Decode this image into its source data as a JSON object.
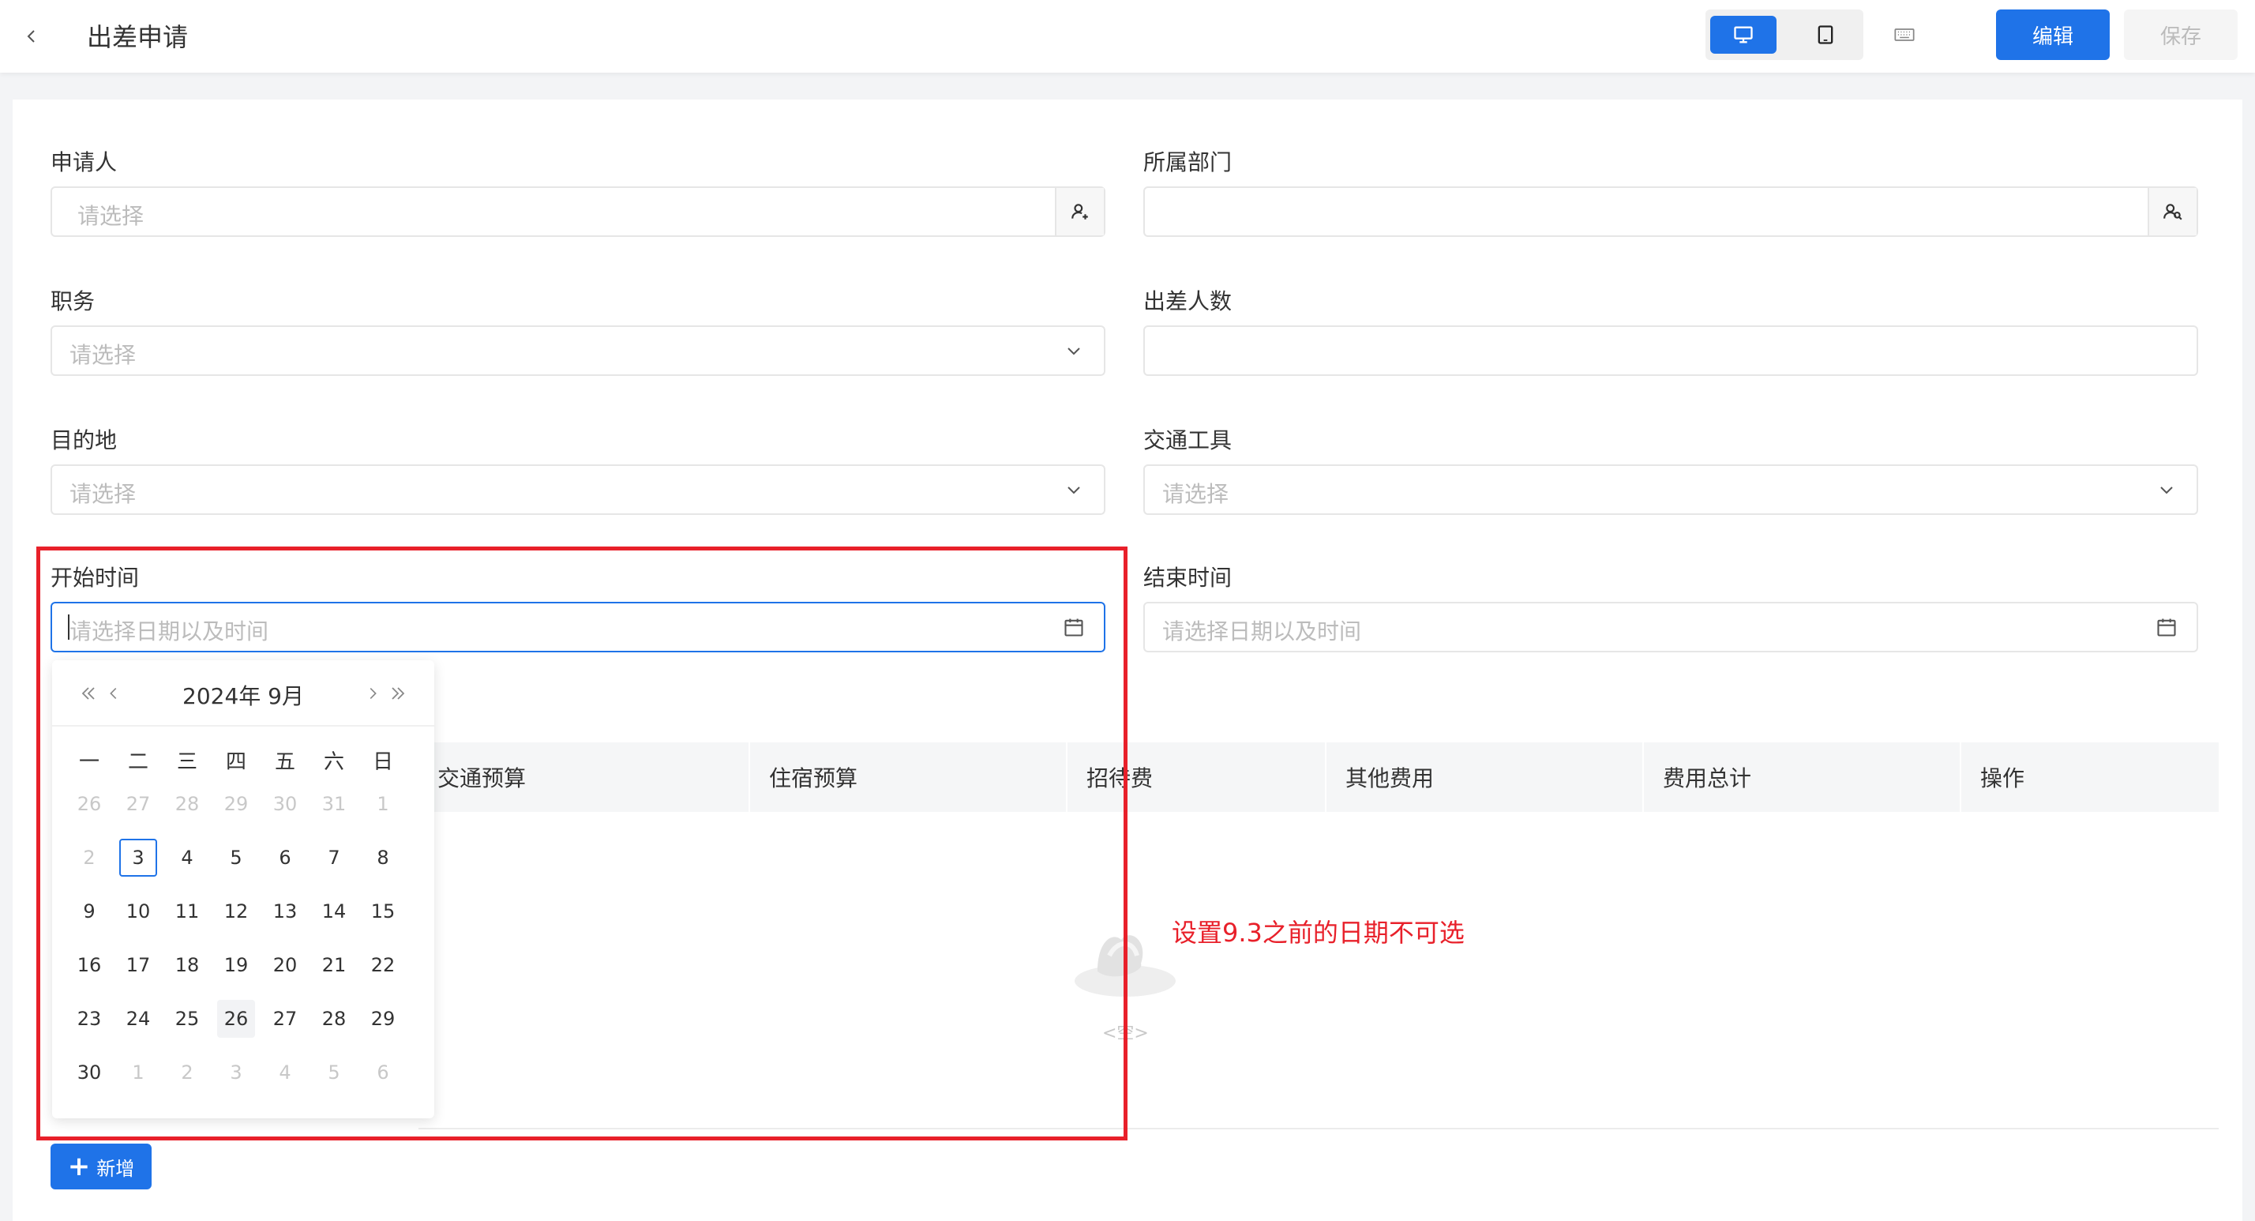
{
  "header": {
    "title": "出差申请",
    "edit_label": "编辑",
    "save_label": "保存"
  },
  "form": {
    "applicant": {
      "label": "申请人",
      "placeholder": "请选择"
    },
    "department": {
      "label": "所属部门",
      "placeholder": ""
    },
    "position": {
      "label": "职务",
      "placeholder": "请选择"
    },
    "headcount": {
      "label": "出差人数",
      "placeholder": ""
    },
    "destination": {
      "label": "目的地",
      "placeholder": "请选择"
    },
    "transport": {
      "label": "交通工具",
      "placeholder": "请选择"
    },
    "start_time": {
      "label": "开始时间",
      "placeholder": "请选择日期以及时间"
    },
    "end_time": {
      "label": "结束时间",
      "placeholder": "请选择日期以及时间"
    }
  },
  "table": {
    "columns": [
      "交通预算",
      "住宿预算",
      "招待费",
      "其他费用",
      "费用总计",
      "操作"
    ],
    "empty_text": "<空>"
  },
  "add_label": "新增",
  "calendar": {
    "title": "2024年 9月",
    "weekdays": [
      "一",
      "二",
      "三",
      "四",
      "五",
      "六",
      "日"
    ],
    "weeks": [
      [
        "26",
        "27",
        "28",
        "29",
        "30",
        "31",
        "1"
      ],
      [
        "2",
        "3",
        "4",
        "5",
        "6",
        "7",
        "8"
      ],
      [
        "9",
        "10",
        "11",
        "12",
        "13",
        "14",
        "15"
      ],
      [
        "16",
        "17",
        "18",
        "19",
        "20",
        "21",
        "22"
      ],
      [
        "23",
        "24",
        "25",
        "26",
        "27",
        "28",
        "29"
      ],
      [
        "30",
        "1",
        "2",
        "3",
        "4",
        "5",
        "6"
      ]
    ],
    "today": "3",
    "hovered": "26"
  },
  "annotation": {
    "text": "设置9.3之前的日期不可选",
    "color": "#e8202a"
  },
  "colors": {
    "primary": "#1f73e8"
  }
}
